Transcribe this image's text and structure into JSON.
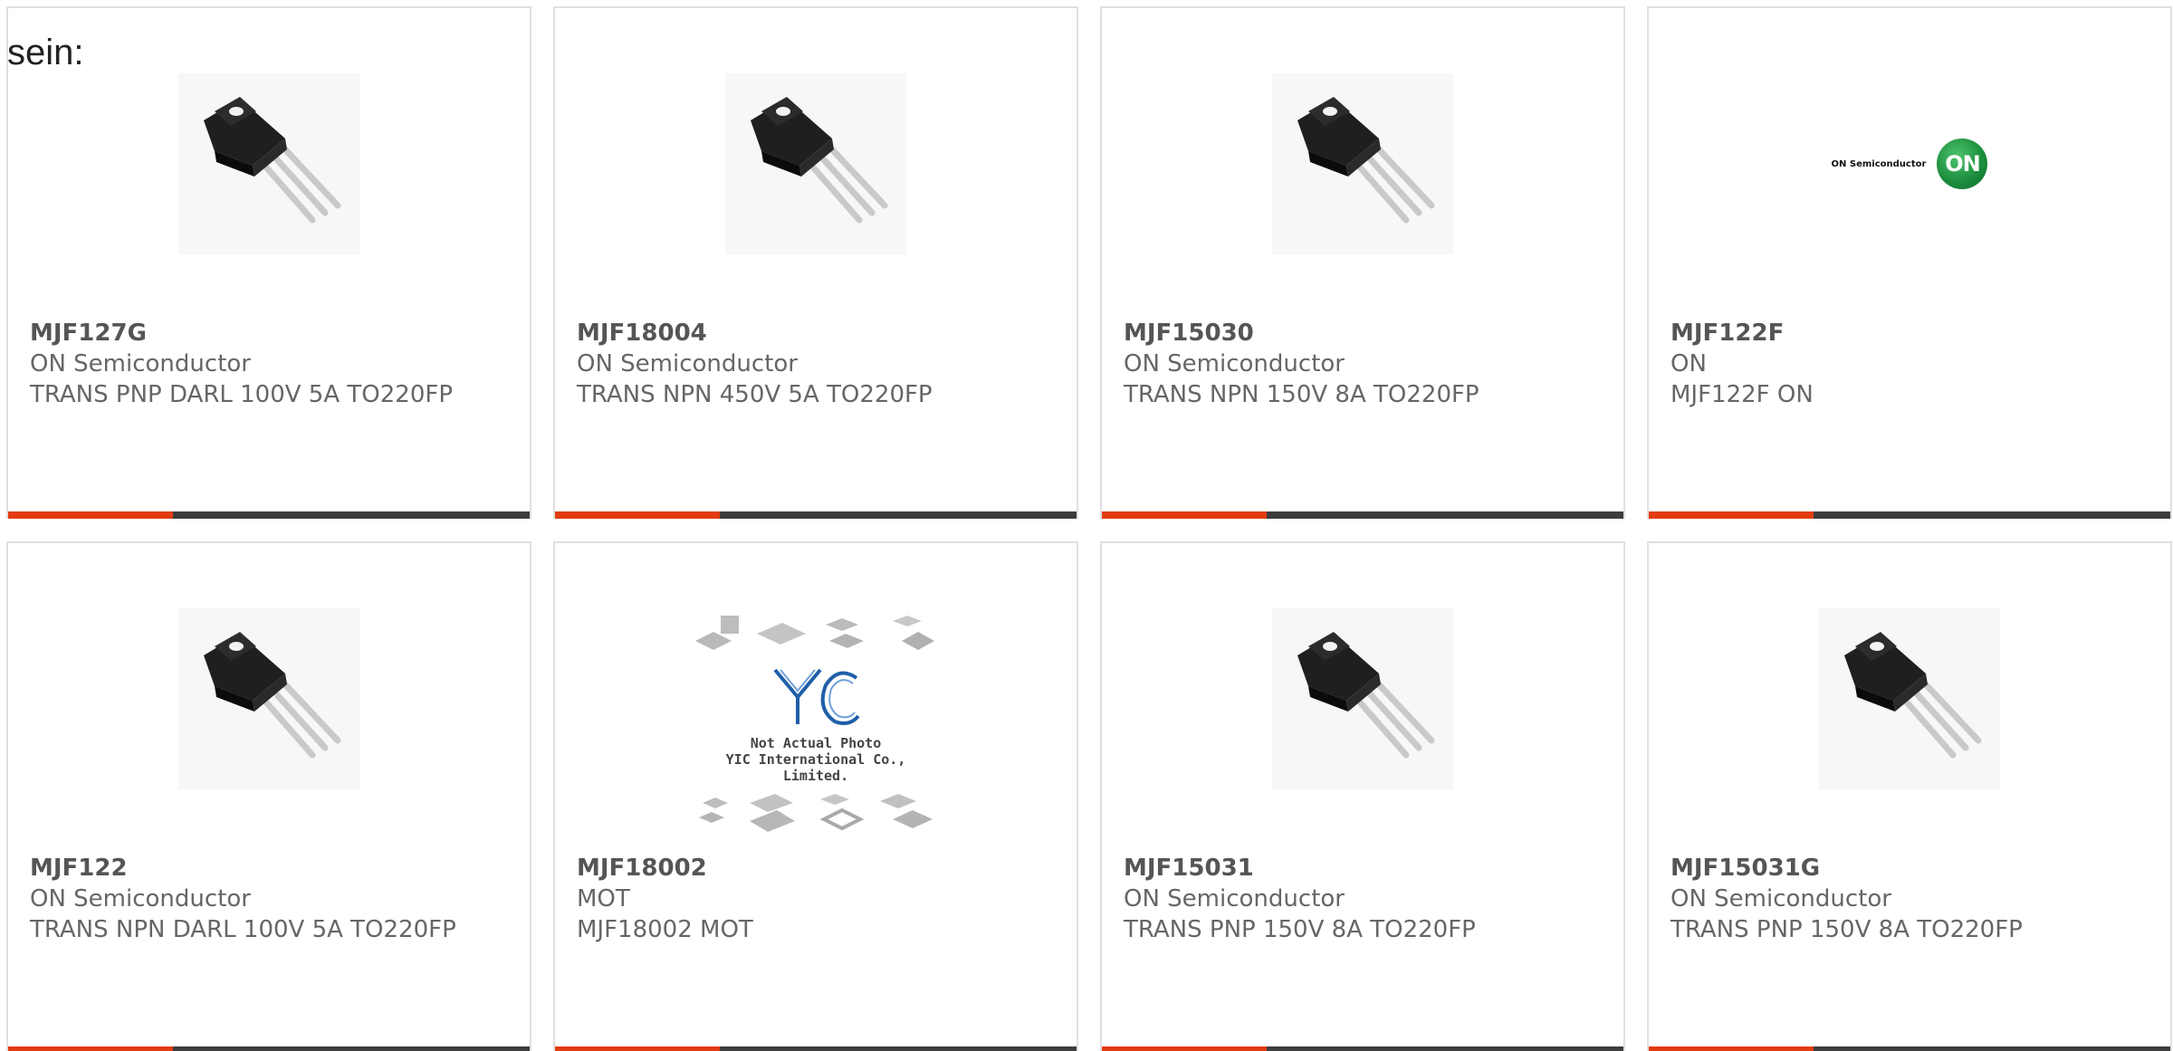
{
  "intro_text": "sein:",
  "products": [
    {
      "part": "MJF127G",
      "maker": "ON Semiconductor",
      "desc": "TRANS PNP DARL 100V 5A TO220FP",
      "image": "transistor-to220-photo"
    },
    {
      "part": "MJF18004",
      "maker": "ON Semiconductor",
      "desc": "TRANS NPN 450V 5A TO220FP",
      "image": "transistor-to220-photo"
    },
    {
      "part": "MJF15030",
      "maker": "ON Semiconductor",
      "desc": "TRANS NPN 150V 8A TO220FP",
      "image": "transistor-to220-photo"
    },
    {
      "part": "MJF122F",
      "maker": "ON",
      "desc": "MJF122F ON",
      "image": "on-semiconductor-logo",
      "logo_text": "ON Semiconductor",
      "logo_mark": "ON"
    },
    {
      "part": "MJF122",
      "maker": "ON Semiconductor",
      "desc": "TRANS NPN DARL 100V 5A TO220FP",
      "image": "transistor-to220-photo"
    },
    {
      "part": "MJF18002",
      "maker": "MOT",
      "desc": "MJF18002 MOT",
      "image": "yic-placeholder",
      "placeholder_line1": "Not Actual Photo",
      "placeholder_line2": "YIC International Co., Limited."
    },
    {
      "part": "MJF15031",
      "maker": "ON Semiconductor",
      "desc": "TRANS PNP 150V 8A TO220FP",
      "image": "transistor-to220-photo"
    },
    {
      "part": "MJF15031G",
      "maker": "ON Semiconductor",
      "desc": "TRANS PNP 150V 8A TO220FP",
      "image": "transistor-to220-photo"
    }
  ],
  "colors": {
    "accent": "#e23c12",
    "bar": "#3d3d3d",
    "text": "#666666",
    "border": "#e0e0e0"
  }
}
